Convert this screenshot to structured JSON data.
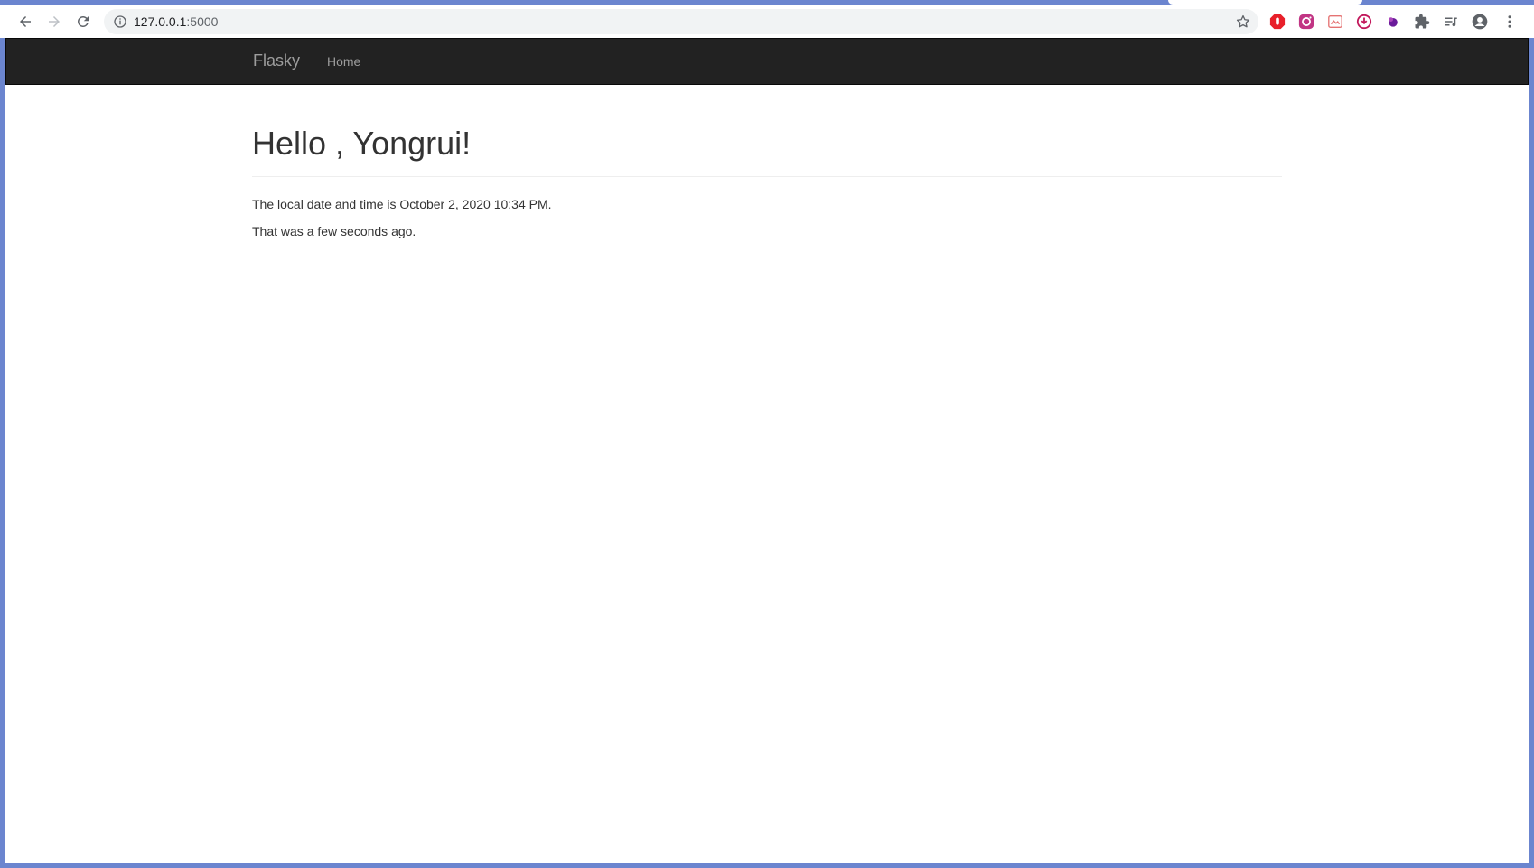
{
  "browser": {
    "address_bar": {
      "host": "127.0.0.1",
      "port": ":5000"
    },
    "extensions": [
      "adblock-icon",
      "instagram-icon",
      "extension-icon",
      "download-icon",
      "theme-icon",
      "puzzle-icon",
      "media-icon",
      "profile-icon",
      "menu-icon"
    ]
  },
  "navbar": {
    "brand": "Flasky",
    "links": [
      {
        "label": "Home"
      }
    ]
  },
  "main": {
    "heading": "Hello , Yongrui!",
    "datetime_text": "The local date and time is October 2, 2020 10:34 PM.",
    "relative_text": "That was a few seconds ago."
  }
}
